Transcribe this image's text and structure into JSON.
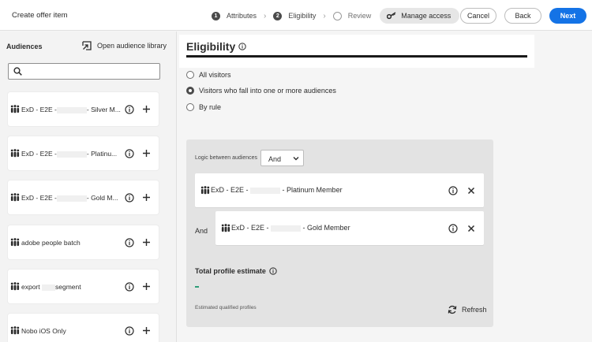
{
  "header": {
    "title": "Create offer item",
    "steps": [
      {
        "num": "1",
        "label": "Attributes"
      },
      {
        "num": "2",
        "label": "Eligibility"
      },
      {
        "num": "",
        "label": "Review"
      }
    ],
    "manage_access": "Manage access",
    "cancel": "Cancel",
    "back": "Back",
    "next": "Next"
  },
  "sidebar": {
    "title": "Audiences",
    "open_library": "Open audience library",
    "search": {
      "value": "",
      "placeholder": ""
    },
    "items": [
      {
        "prefix": "ExD - E2E -",
        "suffix": "- Silver M..."
      },
      {
        "prefix": "ExD - E2E -",
        "suffix": "- Platinu..."
      },
      {
        "prefix": "ExD - E2E -",
        "suffix": "- Gold M..."
      },
      {
        "prefix": "adobe people batch",
        "suffix": ""
      },
      {
        "prefix": "export",
        "suffix": "segment"
      },
      {
        "prefix": "Nobo iOS Only",
        "suffix": ""
      }
    ]
  },
  "main": {
    "heading": "Eligibility",
    "options": [
      {
        "label": "All visitors",
        "selected": false
      },
      {
        "label": "Visitors who fall into one or more audiences",
        "selected": true
      },
      {
        "label": "By rule",
        "selected": false
      }
    ],
    "logic_label": "Logic between audiences",
    "logic_value": "And",
    "selected_audiences": [
      {
        "prefix": "ExD - E2E -",
        "suffix": "- Platinum Member"
      },
      {
        "prefix": "ExD - E2E -",
        "suffix": "- Gold Member"
      }
    ],
    "and_label": "And",
    "total_estimate_label": "Total profile estimate",
    "total_estimate_value": "-",
    "estimated_label": "Estimated qualified profiles",
    "refresh": "Refresh"
  },
  "colors": {
    "accent": "#1473e6",
    "estimate": "#2d9d78"
  }
}
